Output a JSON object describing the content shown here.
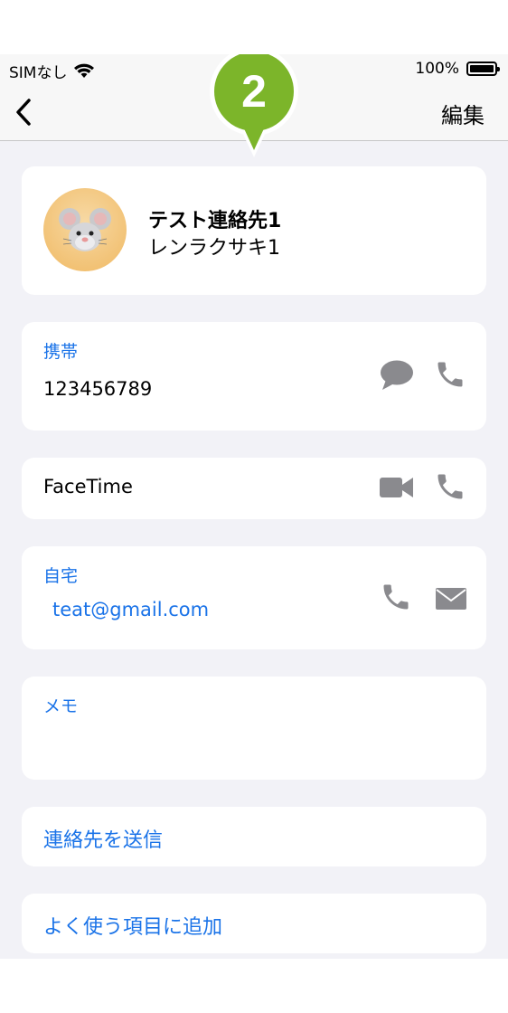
{
  "status": {
    "carrier": "SIMなし",
    "battery_text": "100%",
    "battery_level": 1.0
  },
  "nav": {
    "back_icon": "chevron-left-icon",
    "edit_label": "編集",
    "step_number": "2",
    "step_color": "#7cb52a"
  },
  "contact": {
    "name": "テスト連絡先1",
    "kana": "レンラクサキ1",
    "avatar_icon": "mouse-face-icon"
  },
  "phone": {
    "label": "携帯",
    "number": "123456789",
    "icons": [
      "message-icon",
      "phone-icon"
    ]
  },
  "facetime": {
    "label": "FaceTime",
    "icons": [
      "video-camera-icon",
      "phone-icon"
    ]
  },
  "email": {
    "label": "自宅",
    "address": "teat@gmail.com",
    "icons": [
      "phone-icon",
      "mail-icon"
    ]
  },
  "memo": {
    "label": "メモ",
    "value": ""
  },
  "actions": {
    "send_contact": "連絡先を送信",
    "add_favorites": "よく使う項目に追加"
  },
  "colors": {
    "accent": "#1a73e8",
    "background": "#f2f2f7",
    "icon_gray": "#8a8a8e"
  }
}
